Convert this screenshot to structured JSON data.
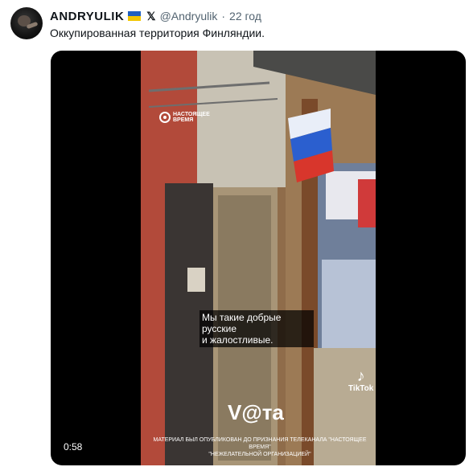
{
  "author": {
    "name": "ANDRYULIK",
    "handle": "@Andryulik",
    "separator": "·",
    "time": "22 год"
  },
  "tweet": {
    "text": "Оккупированная территория Финляндии."
  },
  "video": {
    "duration": "0:58",
    "channel_line1": "НАСТОЯЩЕЕ",
    "channel_line2": "ВРЕМЯ",
    "caption_line1": "Мы такие добрые русские",
    "caption_line2": "и жалостливые.",
    "watermark": "V@та",
    "tiktok_label": "TikTok",
    "disclaimer_line1": "МАТЕРИАЛ БЫЛ ОПУБЛИКОВАН ДО ПРИЗНАНИЯ ТЕЛЕКАНАЛА \"НАСТОЯЩЕЕ ВРЕМЯ\"",
    "disclaimer_line2": "\"НЕЖЕЛАТЕЛЬНОЙ ОРГАНИЗАЦИЕЙ\""
  },
  "colors": {
    "flag_blue": "#1f5fbf",
    "flag_yellow": "#f2c500",
    "handle_gray": "#536471"
  }
}
